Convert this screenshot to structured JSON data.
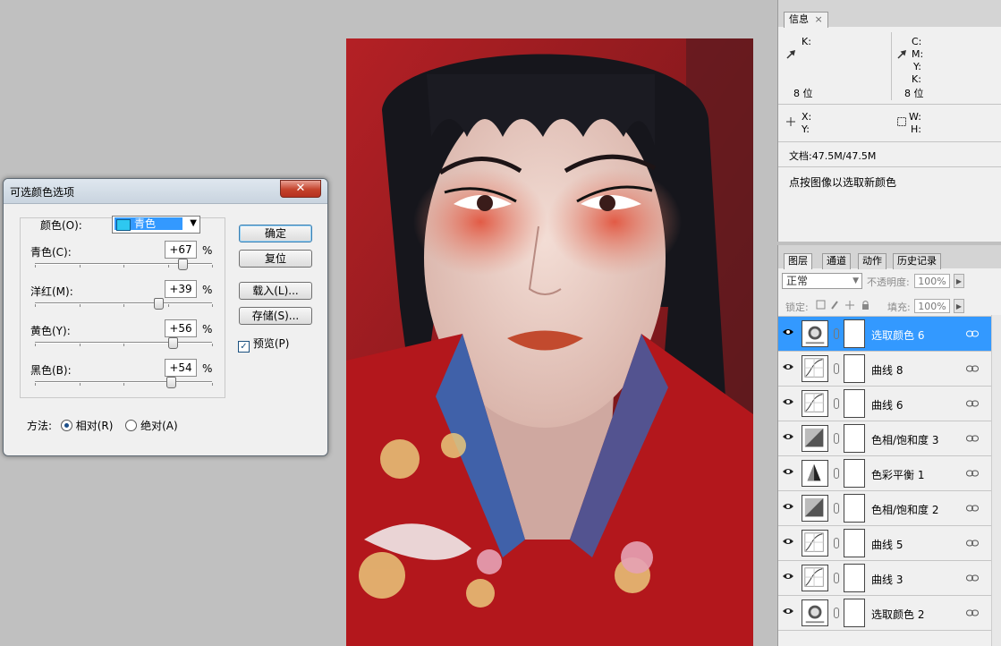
{
  "dialog": {
    "title": "可选颜色选项",
    "close_symbol": "✕",
    "color_label": "颜色(O):",
    "color_selected": "青色",
    "sliders": [
      {
        "label": "青色(C):",
        "value": "+67",
        "unit": "%",
        "position": 0.835
      },
      {
        "label": "洋红(M):",
        "value": "+39",
        "unit": "%",
        "position": 0.695
      },
      {
        "label": "黄色(Y):",
        "value": "+56",
        "unit": "%",
        "position": 0.78
      },
      {
        "label": "黑色(B):",
        "value": "+54",
        "unit": "%",
        "position": 0.77
      }
    ],
    "buttons": {
      "ok": "确定",
      "reset": "复位",
      "load": "载入(L)...",
      "save": "存储(S)..."
    },
    "preview_label": "预览(P)",
    "preview_checked": true,
    "method_label": "方法:",
    "method_relative": "相对(R)",
    "method_absolute": "绝对(A)"
  },
  "info_panel": {
    "tab": "信息",
    "tab_close": "×",
    "k_label": "K:",
    "c_label": "C:",
    "m_label": "M:",
    "y_label": "Y:",
    "k2_label": "K:",
    "bits_left": "8 位",
    "bits_right": "8 位",
    "x_label": "X:",
    "y2_label": "Y:",
    "w_label": "W:",
    "h_label": "H:",
    "doc": "文档:47.5M/47.5M",
    "hint": "点按图像以选取新颜色"
  },
  "layers_panel": {
    "tabs": [
      "图层",
      "通道",
      "动作",
      "历史记录"
    ],
    "blend_mode": "正常",
    "opacity_label": "不透明度:",
    "opacity_value": "100%",
    "lock_label": "锁定:",
    "fill_label": "填充:",
    "fill_value": "100%",
    "layers": [
      {
        "name": "选取颜色 6",
        "type": "selective",
        "selected": true
      },
      {
        "name": "曲线 8",
        "type": "curves",
        "selected": false
      },
      {
        "name": "曲线 6",
        "type": "curves",
        "selected": false
      },
      {
        "name": "色相/饱和度 3",
        "type": "hue",
        "selected": false
      },
      {
        "name": "色彩平衡 1",
        "type": "balance",
        "selected": false
      },
      {
        "name": "色相/饱和度 2",
        "type": "hue",
        "selected": false
      },
      {
        "name": "曲线 5",
        "type": "curves",
        "selected": false
      },
      {
        "name": "曲线 3",
        "type": "curves",
        "selected": false
      },
      {
        "name": "选取颜色 2",
        "type": "selective",
        "selected": false
      }
    ]
  }
}
